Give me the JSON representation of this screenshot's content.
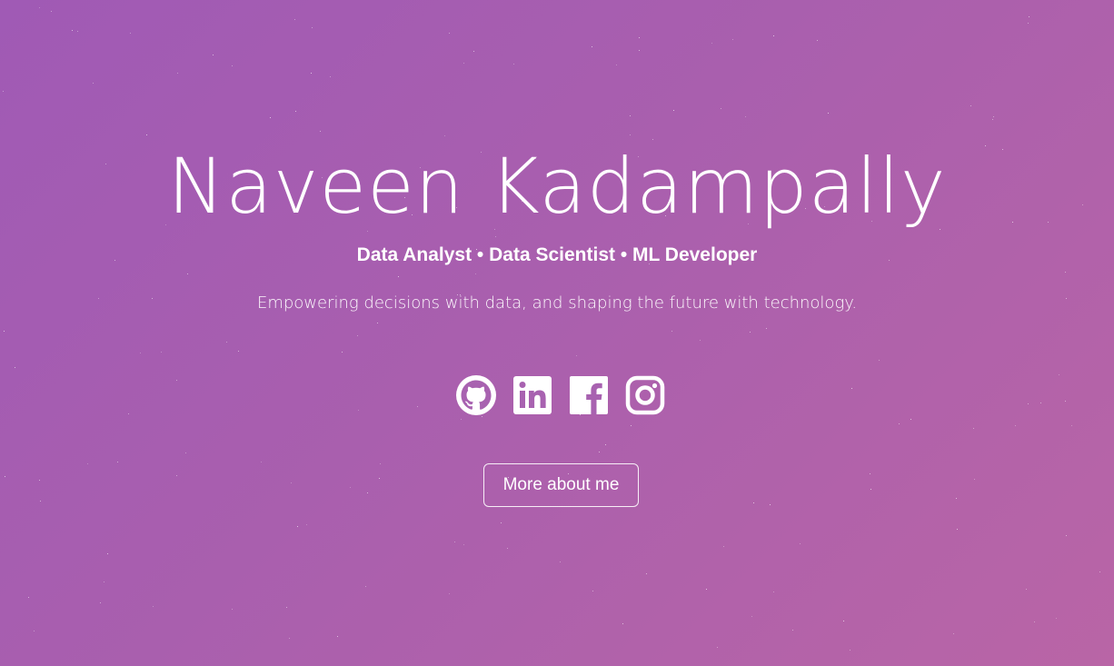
{
  "hero": {
    "name": "Naveen Kadampally",
    "roles": "Data Analyst • Data Scientist • ML Developer",
    "tagline": "Empowering decisions with data, and shaping the future with technology.",
    "cta_label": "More about me"
  },
  "socials": [
    {
      "name": "github",
      "icon": "github-icon"
    },
    {
      "name": "linkedin",
      "icon": "linkedin-icon"
    },
    {
      "name": "facebook",
      "icon": "facebook-icon"
    },
    {
      "name": "instagram",
      "icon": "instagram-icon"
    }
  ],
  "colors": {
    "gradient_start": "#a05ab5",
    "gradient_end": "#b965a6",
    "text": "#ffffff"
  }
}
